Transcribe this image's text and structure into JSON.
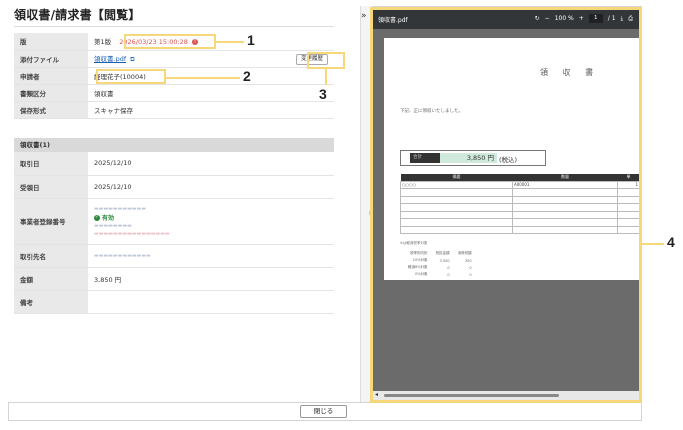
{
  "page": {
    "title": "領収書/請求書【閲覧】",
    "close_label": "閉じる"
  },
  "header_fields": [
    {
      "key": "版",
      "value": "第1版",
      "extra": "2026/03/23 15:00:28"
    },
    {
      "key": "添付ファイル",
      "value": "領収書.pdf",
      "button": "変更履歴"
    },
    {
      "key": "申請者",
      "value": "経理花子(10004)"
    },
    {
      "key": "書類区分",
      "value": "領収書"
    },
    {
      "key": "保存形式",
      "value": "スキャナ保存"
    }
  ],
  "section": {
    "title": "領収書(1)",
    "fields": [
      {
        "key": "取引日",
        "value": "2025/12/10"
      },
      {
        "key": "受領日",
        "value": "2025/12/10"
      },
      {
        "key": "事業者登録番号",
        "value": "有効"
      },
      {
        "key": "取引先名",
        "value": ""
      },
      {
        "key": "金額",
        "value": "3,850 円"
      },
      {
        "key": "備考",
        "value": ""
      }
    ]
  },
  "callouts": [
    "1",
    "2",
    "3",
    "4"
  ],
  "viewer": {
    "filename": "領収書.pdf",
    "zoom": "100 %",
    "page_current": "1",
    "page_total": "/ 1",
    "doc_title": "領 収 書",
    "doc_text": "下記、正に領収いたしました。",
    "total_label": "合計",
    "total_value": "3,850 円",
    "total_tax": "(税込)",
    "table_headers": [
      "摘要",
      "数量",
      "単"
    ],
    "table_first_row": [
      "○○○○",
      "A00001",
      "1"
    ],
    "note": "※は軽減税率対象",
    "tax_headers": [
      "税率別内訳",
      "税抜金額",
      "消費税額"
    ],
    "tax_rows": [
      [
        "10%対象",
        "3,500",
        "350"
      ],
      [
        "軽減8%対象",
        "0",
        "0"
      ],
      [
        "0%対象",
        "0",
        "0"
      ]
    ]
  },
  "colors": {
    "highlight": "#f6d77a",
    "error": "#d9534f",
    "valid": "#2a8a3a",
    "link": "#1a5fb4"
  }
}
